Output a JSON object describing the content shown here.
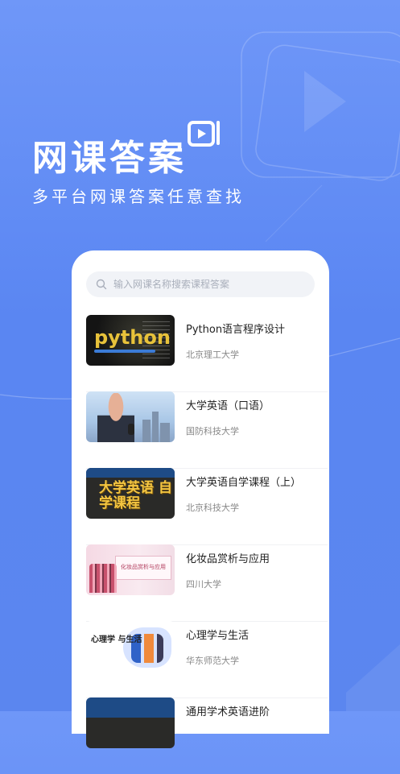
{
  "header": {
    "title": "网课答案",
    "subtitle": "多平台网课答案任意查找"
  },
  "search": {
    "placeholder": "输入网课名称搜索课程答案"
  },
  "courses": [
    {
      "title": "Python语言程序设计",
      "school": "北京理工大学",
      "thumb_text": "python"
    },
    {
      "title": "大学英语（口语）",
      "school": "国防科技大学"
    },
    {
      "title": "大学英语自学课程（上）",
      "school": "北京科技大学",
      "thumb_text": "大学英语 自学课程"
    },
    {
      "title": "化妆品赏析与应用",
      "school": "四川大学",
      "thumb_text": "化妆品赏析与应用"
    },
    {
      "title": "心理学与生活",
      "school": "华东师范大学",
      "thumb_text": "心理学 与生活"
    },
    {
      "title": "通用学术英语进阶",
      "school": ""
    }
  ],
  "colors": {
    "background_top": "#6f97f8",
    "background_bottom": "#5b86ef",
    "card": "#ffffff",
    "title_text": "#ffffff"
  },
  "icons": {
    "title_icon": "video-play-icon",
    "search_icon": "search-icon"
  }
}
